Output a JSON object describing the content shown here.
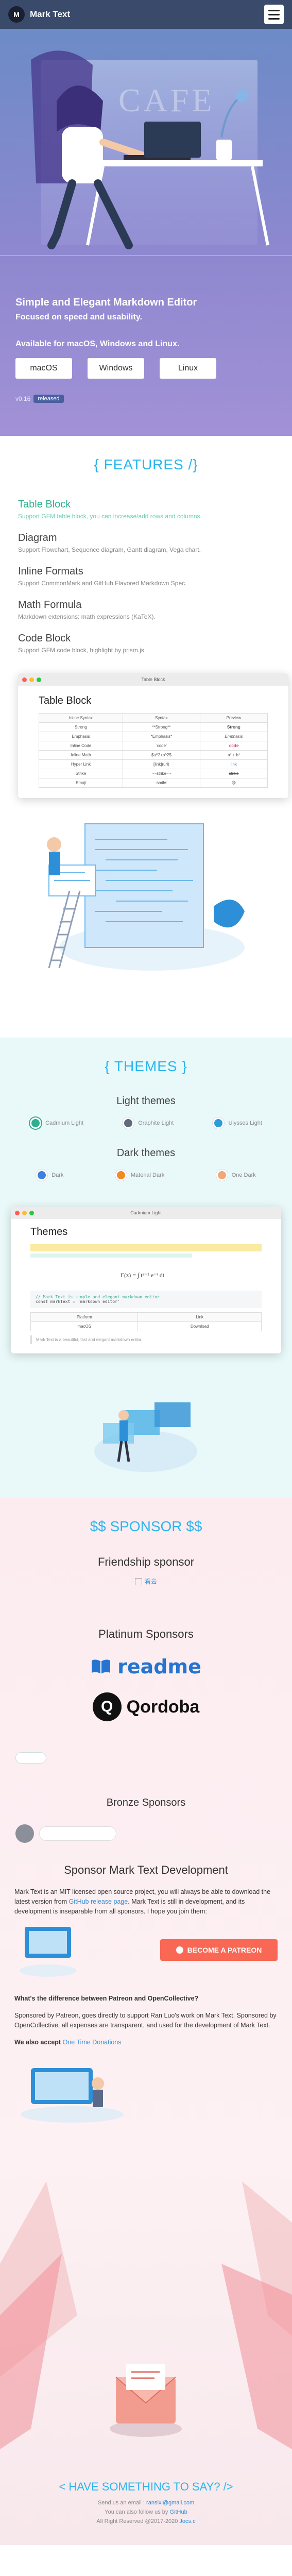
{
  "nav": {
    "logo_letter": "M",
    "brand": "Mark Text"
  },
  "hero": {
    "art_text": "CAFE",
    "title": "Simple and Elegant Markdown Editor",
    "subtitle": "Focused on speed and usability.",
    "availability": "Available for macOS, Windows and Linux.",
    "downloads": [
      "macOS",
      "Windows",
      "Linux"
    ],
    "version_label": "v0.16",
    "version_badge": "released"
  },
  "features": {
    "title": "{ FEATURES /}",
    "items": [
      {
        "name": "Table Block",
        "desc": "Support GFM table block, you can increase/add rows and columns."
      },
      {
        "name": "Diagram",
        "desc": "Support Flowchart, Sequence diagram, Gantt diagram, Vega chart."
      },
      {
        "name": "Inline Formats",
        "desc": "Support CommonMark and GitHub Flavored Markdown Spec."
      },
      {
        "name": "Math Formula",
        "desc": "Markdown extensions: math expressions (KaTeX)."
      },
      {
        "name": "Code Block",
        "desc": "Support GFM code block, highlight by prism.js."
      }
    ],
    "window_title": "Table Block",
    "doc_heading": "Table Block",
    "table": {
      "headers": [
        "Inline Syntax",
        "Syntax",
        "Preview"
      ],
      "rows": [
        [
          "Strong",
          "**Strong**",
          "Strong"
        ],
        [
          "Emphasis",
          "*Emphasis*",
          "Emphasis"
        ],
        [
          "Inline Code",
          "`code`",
          "code"
        ],
        [
          "Inline Math",
          "$a^2+b^2$",
          "a² + b²"
        ],
        [
          "Hyper Link",
          "[link](url)",
          "link"
        ],
        [
          "Strike",
          "~~strike~~",
          "strike"
        ],
        [
          "Emoji",
          ":smile:",
          "😄"
        ]
      ]
    }
  },
  "themes": {
    "title": "{ THEMES }",
    "light_heading": "Light themes",
    "light": [
      {
        "name": "Cadmium Light",
        "color": "#2eaf8f"
      },
      {
        "name": "Graphite Light",
        "color": "#5d6b7a"
      },
      {
        "name": "Ulysses Light",
        "color": "#2b9cd8"
      }
    ],
    "dark_heading": "Dark themes",
    "dark": [
      {
        "name": "Dark",
        "color": "#3b82e0"
      },
      {
        "name": "Material Dark",
        "color": "#f08a24"
      },
      {
        "name": "One Dark",
        "color": "#f0a87a"
      }
    ],
    "window_title": "Cadmium Light",
    "doc_heading": "Themes",
    "code_comment": "// Mark Text is simple and elegant markdown editor",
    "code_line": "const markText = 'markdown editor'",
    "table_headers": [
      "Platform",
      "Link"
    ],
    "table_rows": [
      [
        "macOS",
        "Download"
      ]
    ],
    "quote": "Mark Text is a beautiful, fast and elegant markdown editor."
  },
  "sponsor": {
    "title": "$$ SPONSOR $$",
    "friendship_heading": "Friendship sponsor",
    "friendship_alt": "看云",
    "platinum_heading": "Platinum Sponsors",
    "platinum": [
      "readme",
      "Qordoba"
    ],
    "bronze_heading": "Bronze Sponsors",
    "develop_heading": "Sponsor Mark Text Development",
    "develop_text_1": "Mark Text is an MIT licensed open source project, you will always be able to download the latest version from ",
    "develop_link": "GitHub release page",
    "develop_text_2": ". Mark Text is still in development, and its development is inseparable from all sponsors. I hope you join them:",
    "patreon_label": "BECOME A PATREON",
    "diff_heading": "What's the difference between Patreon and OpenCollective?",
    "diff_text": "Sponsored by Patreon, goes directly to support Ran Luo's work on Mark Text. Sponsored by OpenCollective, all expenses are transparent, and used for the development of Mark Text.",
    "onetime_prefix": "We also accept ",
    "onetime_link": "One Time Donations"
  },
  "footer": {
    "title": "< HAVE SOMETHING TO SAY? />",
    "email_prefix": "Send us an email : ",
    "email": "ransixi@gmail.com",
    "follow_prefix": "You can also follow us by ",
    "follow_link": "GitHub",
    "copyright": "All Right Reserved @2017-2020",
    "author_link": "Jocs.c"
  }
}
